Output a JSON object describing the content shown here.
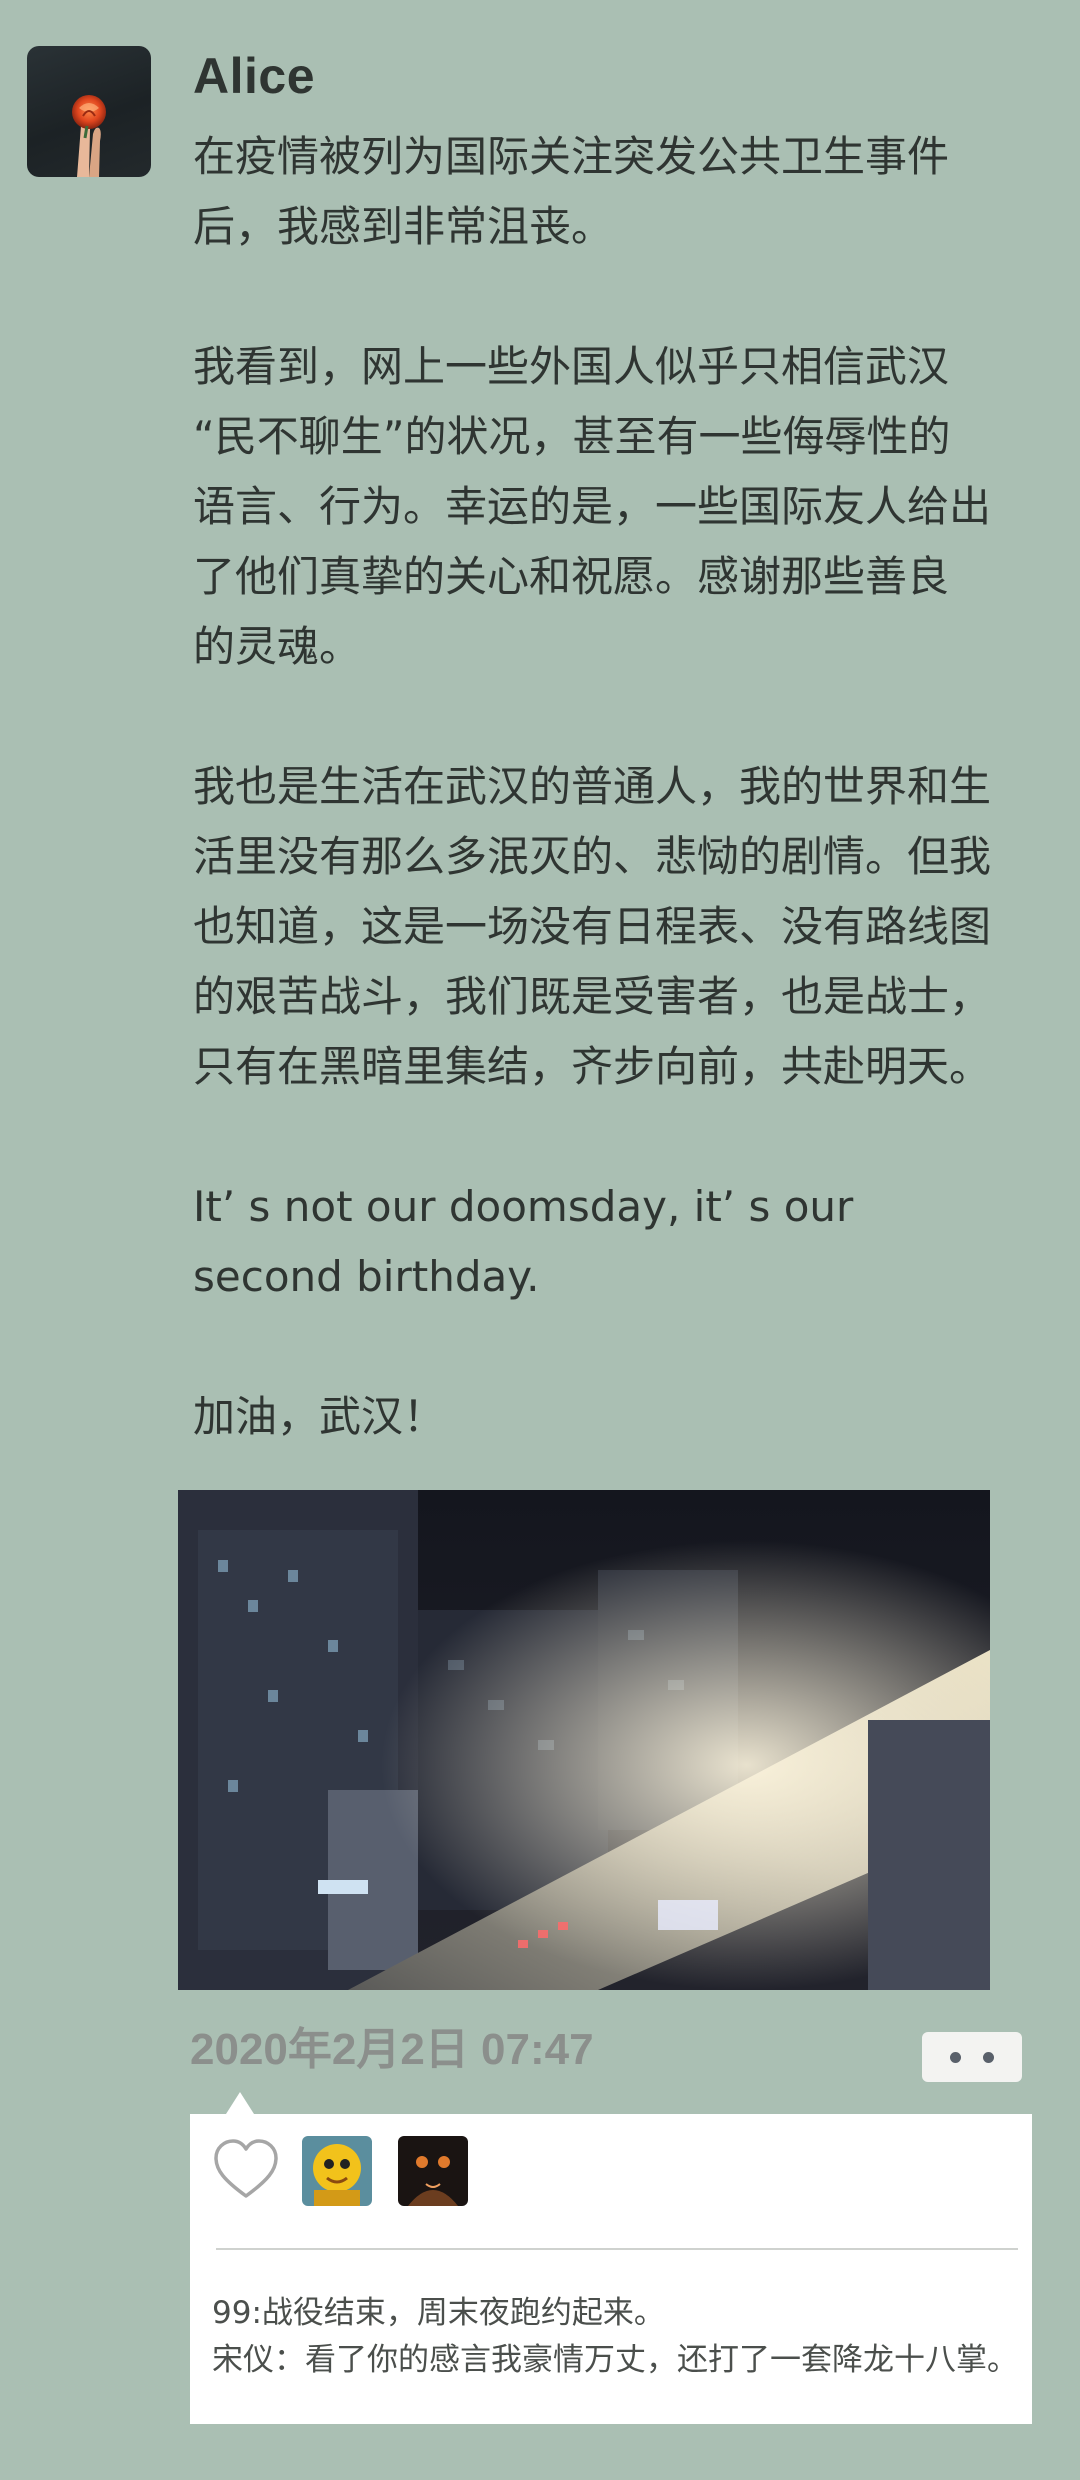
{
  "post": {
    "author": "Alice",
    "paragraphs": [
      "在疫情被列为国际关注突发公共卫生事件\n后，我感到非常沮丧。",
      "我看到，网上一些外国人似乎只相信武汉\n“民不聊生”的状况，甚至有一些侮辱性的\n语言、行为。幸运的是，一些国际友人给出\n了他们真挚的关心和祝愿。感谢那些善良\n的灵魂。",
      "我也是生活在武汉的普通人，我的世界和生\n活里没有那么多泯灭的、悲恸的剧情。但我\n也知道，这是一场没有日程表、没有路线图\n的艰苦战斗，我们既是受害者，也是战士，\n只有在黑暗里集结，齐步向前，共赴明天。",
      "It’ s not our doomsday, it’ s our\nsecond birthday.",
      "加油，武汉！"
    ],
    "timestamp": "2020年2月2日 07:47"
  },
  "interactions": {
    "like_icon": "heart-outline-icon",
    "likers": [
      {
        "avatar": "yellow-cartoon-avatar"
      },
      {
        "avatar": "dark-orange-avatar"
      }
    ],
    "comments": [
      {
        "name": "99",
        "sep": ":",
        "text": "战役结束，周末夜跑约起来。"
      },
      {
        "name": "宋仪",
        "sep": "：",
        "text": "看了你的感言我豪情万丈，还打了一套降龙十八掌。"
      }
    ]
  },
  "colors": {
    "background": "#aabfb3",
    "text": "#2f3532",
    "timestamp": "#8b8f8c",
    "comment_panel": "#ffffff"
  }
}
